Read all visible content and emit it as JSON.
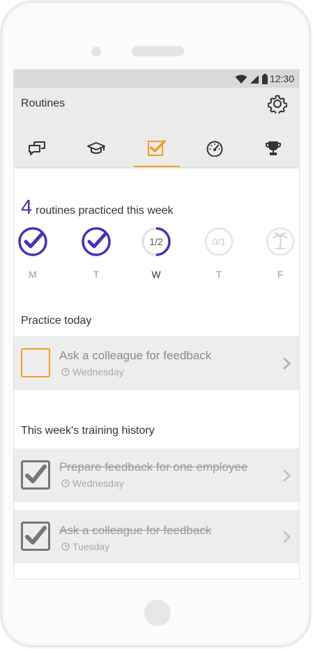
{
  "status_bar": {
    "time": "12:30",
    "icons": [
      "wifi-icon",
      "signal-icon",
      "battery-icon"
    ]
  },
  "app": {
    "title": "Routines"
  },
  "tabs": [
    {
      "icon": "chat-icon",
      "active": false
    },
    {
      "icon": "graduation-cap-icon",
      "active": false
    },
    {
      "icon": "checkbox-icon",
      "active": true
    },
    {
      "icon": "speedometer-icon",
      "active": false
    },
    {
      "icon": "trophy-icon",
      "active": false
    }
  ],
  "weekly": {
    "count": "4",
    "summary_text": "routines practiced this week",
    "days": [
      {
        "label": "M",
        "state": "done"
      },
      {
        "label": "T",
        "state": "done"
      },
      {
        "label": "W",
        "state": "partial",
        "ratio": "1/2",
        "progress": 0.5
      },
      {
        "label": "T",
        "state": "pending",
        "ratio": "0/1"
      },
      {
        "label": "F",
        "state": "off",
        "icon": "palm-tree-icon"
      }
    ]
  },
  "practice_today": {
    "title": "Practice today",
    "items": [
      {
        "title": "Ask a colleague for feedback",
        "day": "Wednesday",
        "done": false
      }
    ]
  },
  "history": {
    "title": "This week's training history",
    "items": [
      {
        "title": "Prepare feedback for one employee",
        "day": "Wednesday",
        "done": true
      },
      {
        "title": "Ask a colleague for feedback ",
        "day": "Tuesday",
        "done": true
      }
    ]
  },
  "colors": {
    "accent": "#f39c23",
    "purple": "#4a2fb5",
    "appbar": "#ebebeb",
    "status_bar": "#d9d9d9"
  }
}
